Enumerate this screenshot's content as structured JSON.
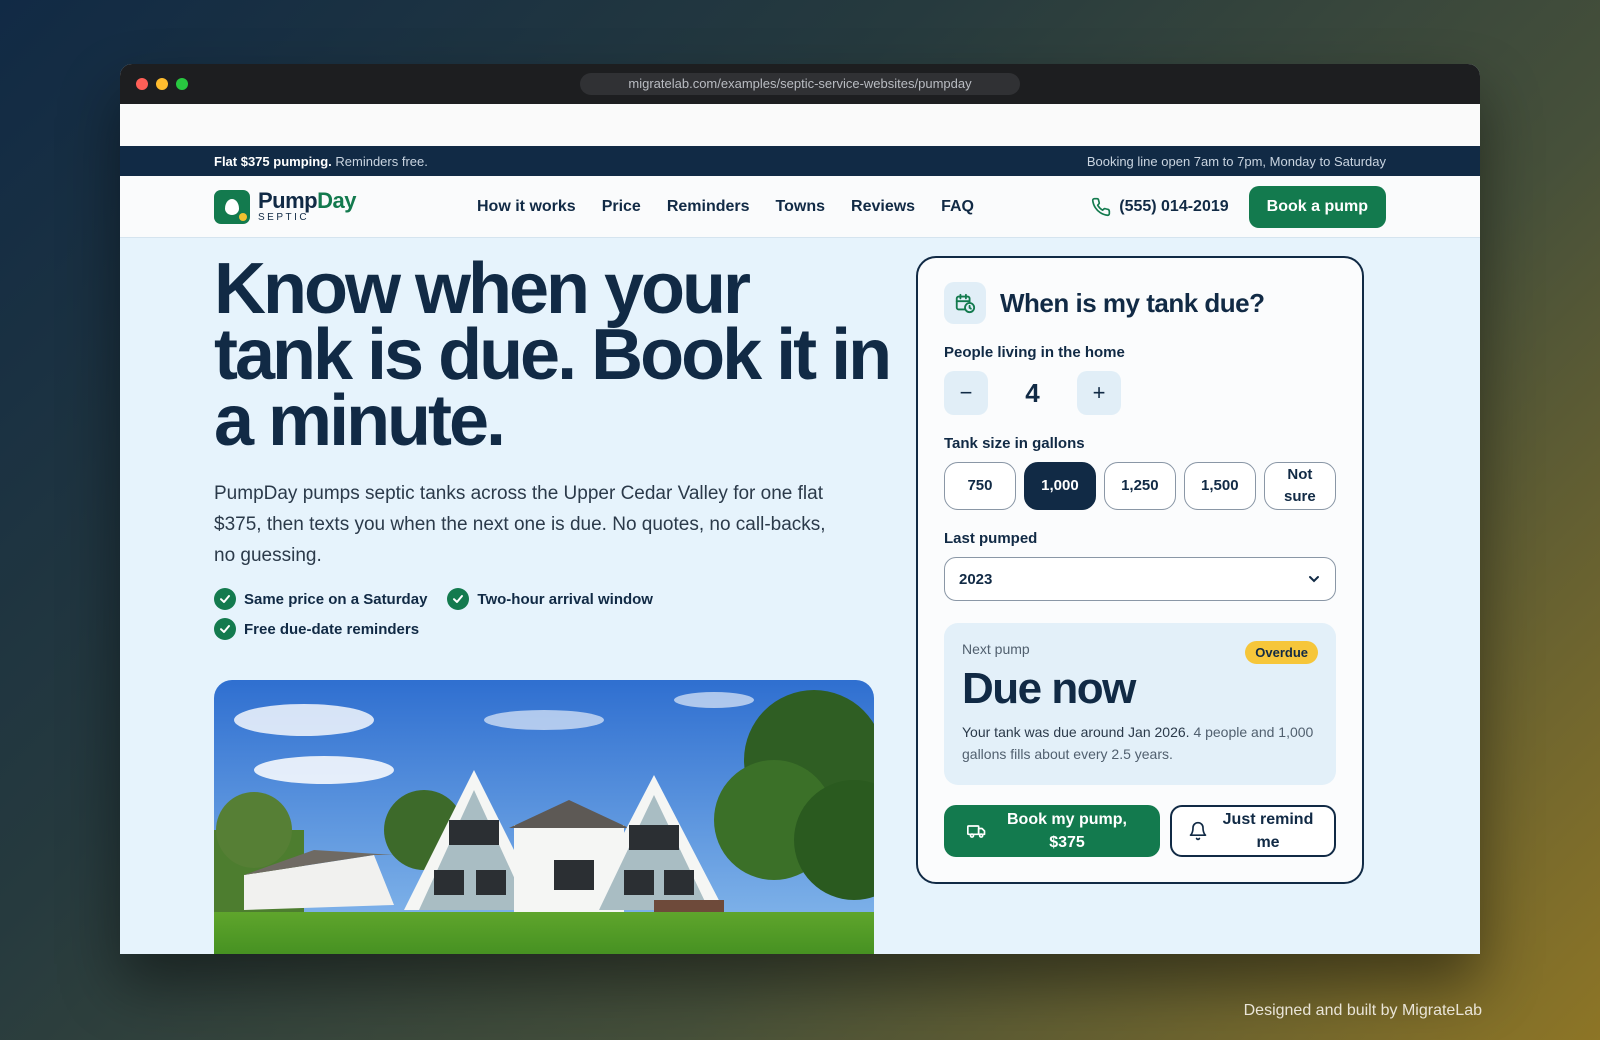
{
  "browser": {
    "url": "migratelab.com/examples/septic-service-websites/pumpday"
  },
  "topbar": {
    "promo_bold": "Flat $375 pumping.",
    "promo_rest": "Reminders free.",
    "hours": "Booking line open 7am to 7pm, Monday to Saturday"
  },
  "brand": {
    "name_part1": "Pump",
    "name_part2": "Day",
    "sub": "SEPTIC",
    "color_primary": "#137a4e",
    "color_navy": "#112a45"
  },
  "nav": {
    "links": [
      "How it works",
      "Price",
      "Reminders",
      "Towns",
      "Reviews",
      "FAQ"
    ],
    "phone": "(555) 014-2019",
    "cta": "Book a pump"
  },
  "hero": {
    "title": "Know when your tank is due. Book it in a minute.",
    "description": "PumpDay pumps septic tanks across the Upper Cedar Valley for one flat $375, then texts you when the next one is due. No quotes, no call-backs, no guessing.",
    "checks": [
      "Same price on a Saturday",
      "Two-hour arrival window",
      "Free due-date reminders"
    ]
  },
  "calculator": {
    "title": "When is my tank due?",
    "people_label": "People living in the home",
    "people_value": "4",
    "minus": "−",
    "plus": "+",
    "size_label": "Tank size in gallons",
    "sizes": [
      "750",
      "1,000",
      "1,250",
      "1,500",
      "Not sure"
    ],
    "selected_size": "1,000",
    "last_label": "Last pumped",
    "last_value": "2023",
    "result_label": "Next pump",
    "badge": "Overdue",
    "result_big": "Due now",
    "result_main": "Your tank was due around Jan 2026.",
    "result_soft": "4 people and 1,000 gallons fills about every 2.5 years.",
    "book_btn": "Book my pump, $375",
    "remind_btn": "Just remind me"
  },
  "footer": {
    "credit": "Designed and built by MigrateLab"
  }
}
